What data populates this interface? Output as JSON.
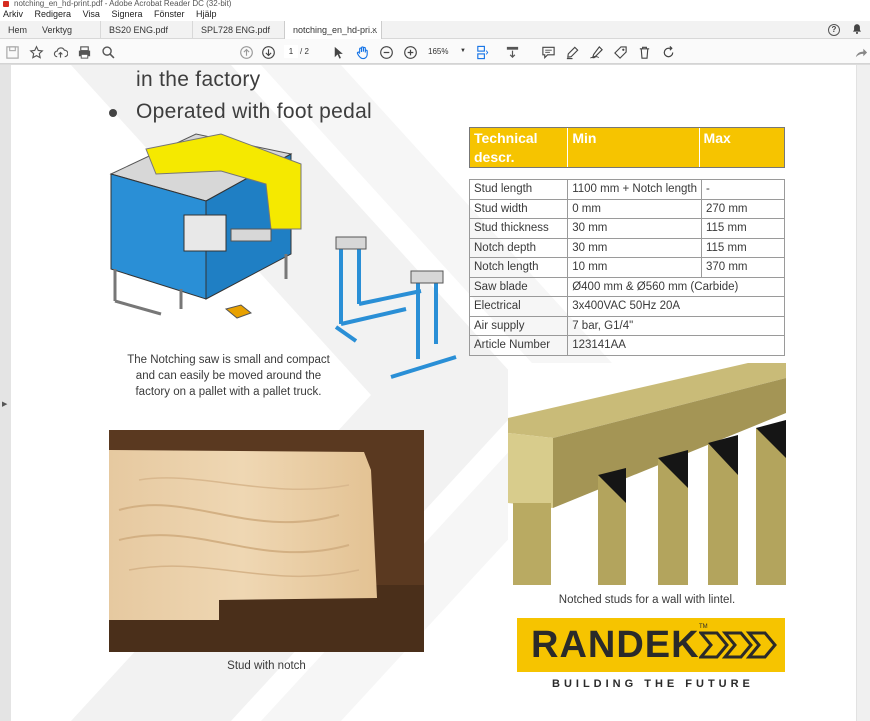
{
  "window": {
    "title": "notching_en_hd-print.pdf - Adobe Acrobat Reader DC (32-bit)"
  },
  "menu": [
    "Arkiv",
    "Redigera",
    "Visa",
    "Signera",
    "Fönster",
    "Hjälp"
  ],
  "tabs": {
    "home": "Hem",
    "tools": "Verktyg",
    "docs": [
      {
        "label": "BS20 ENG.pdf"
      },
      {
        "label": "SPL728 ENG.pdf"
      },
      {
        "label": "notching_en_hd-pri..."
      }
    ],
    "close_glyph": "×"
  },
  "toolbar": {
    "page_current": "1",
    "page_total": "/ 2",
    "zoom": "165%"
  },
  "doc": {
    "bullets": [
      "in the factory",
      "Operated with foot pedal"
    ],
    "machine_caption": [
      "The Notching saw is small and compact",
      "and can easily be moved around the",
      "factory on a pallet with a pallet truck."
    ],
    "stud_caption": "Stud with notch",
    "wall_caption": "Notched studs for a wall with lintel.",
    "logo_name": "RANDEK",
    "logo_tm": "TM",
    "tagline": "BUILDING THE FUTURE",
    "spec_header": {
      "c1": "Technical descr.",
      "c2": "Min",
      "c3": "Max"
    },
    "spec_rows": [
      {
        "label": "Stud length",
        "min": "1100 mm + Notch length",
        "max": "-"
      },
      {
        "label": "Stud width",
        "min": "0 mm",
        "max": "270 mm"
      },
      {
        "label": "Stud thickness",
        "min": "30 mm",
        "max": "115 mm"
      },
      {
        "label": "Notch depth",
        "min": "30 mm",
        "max": "115 mm"
      },
      {
        "label": "Notch length",
        "min": "10 mm",
        "max": "370 mm"
      },
      {
        "label": "Saw blade",
        "min": "Ø400 mm & Ø560 mm (Carbide)",
        "max": ""
      },
      {
        "label": "Electrical",
        "min": "3x400VAC 50Hz 20A",
        "max": ""
      },
      {
        "label": "Air supply",
        "min": "7 bar, G1/4\"",
        "max": ""
      },
      {
        "label": "Article Number",
        "min": "123141AA",
        "max": ""
      }
    ]
  },
  "colors": {
    "brand_yellow": "#f6c400",
    "machine_blue": "#2a8fd6"
  }
}
